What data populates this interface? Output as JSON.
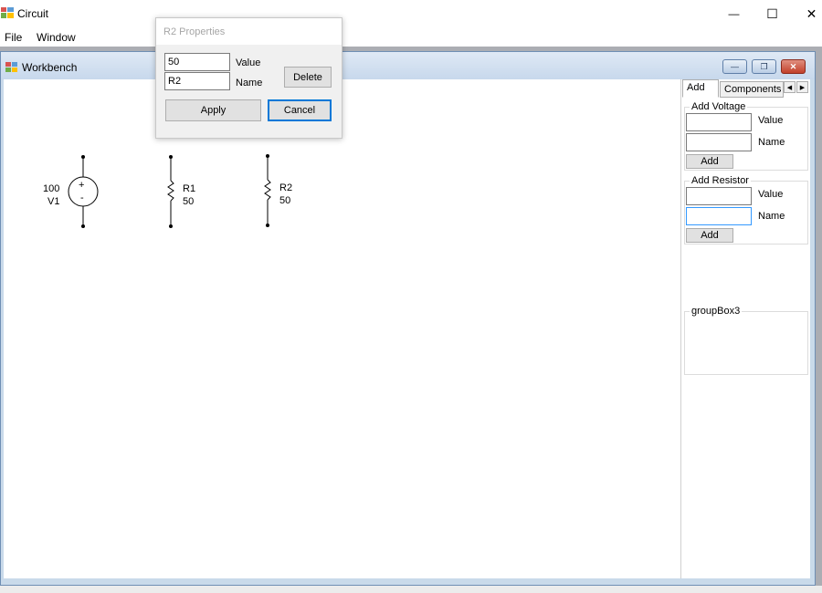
{
  "app": {
    "title": "Circuit",
    "controls": {
      "minimize": "—",
      "maximize": "☐",
      "close": "✕"
    }
  },
  "menu": {
    "items": [
      "File",
      "Window"
    ]
  },
  "workbench": {
    "title": "Workbench",
    "controls": {
      "minimize": "—",
      "restore": "❐",
      "close": "✕"
    },
    "components": [
      {
        "type": "voltage-source",
        "name": "V1",
        "value": "100"
      },
      {
        "type": "resistor",
        "name": "R1",
        "value": "50"
      },
      {
        "type": "resistor",
        "name": "R2",
        "value": "50"
      }
    ]
  },
  "right_panel": {
    "tabs": [
      "Add",
      "Components /"
    ],
    "add_voltage": {
      "title": "Add Voltage",
      "value_label": "Value",
      "name_label": "Name",
      "value": "",
      "name": "",
      "button": "Add"
    },
    "add_resistor": {
      "title": "Add Resistor",
      "value_label": "Value",
      "name_label": "Name",
      "value": "",
      "name": "",
      "button": "Add"
    },
    "group3": {
      "title": "groupBox3"
    }
  },
  "dialog": {
    "title": "R2 Properties",
    "value": "50",
    "value_label": "Value",
    "name": "R2",
    "name_label": "Name",
    "delete_button": "Delete",
    "apply_button": "Apply",
    "cancel_button": "Cancel"
  }
}
